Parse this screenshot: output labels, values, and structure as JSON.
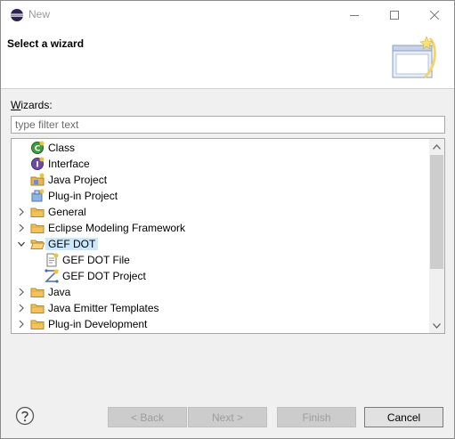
{
  "window": {
    "title": "New",
    "icon": "eclipse-icon"
  },
  "banner": {
    "title": "Select a wizard",
    "art_icon": "new-wizard-banner-icon"
  },
  "wizards": {
    "label_prefix": "W",
    "label_rest": "izards:",
    "filter_placeholder": "type filter text"
  },
  "tree": {
    "items": [
      {
        "label": "Class",
        "icon": "java-class-icon",
        "expandable": false,
        "expanded": false
      },
      {
        "label": "Interface",
        "icon": "java-interface-icon",
        "expandable": false,
        "expanded": false
      },
      {
        "label": "Java Project",
        "icon": "java-project-icon",
        "expandable": false,
        "expanded": false
      },
      {
        "label": "Plug-in Project",
        "icon": "plugin-project-icon",
        "expandable": false,
        "expanded": false
      },
      {
        "label": "General",
        "icon": "folder-icon",
        "expandable": true,
        "expanded": false
      },
      {
        "label": "Eclipse Modeling Framework",
        "icon": "folder-icon",
        "expandable": true,
        "expanded": false
      },
      {
        "label": "GEF DOT",
        "icon": "folder-open-icon",
        "expandable": true,
        "expanded": true,
        "selected": true
      },
      {
        "label": "GEF DOT File",
        "icon": "dot-file-icon",
        "expandable": false,
        "expanded": false,
        "child": true
      },
      {
        "label": "GEF DOT Project",
        "icon": "dot-project-icon",
        "expandable": false,
        "expanded": false,
        "child": true
      },
      {
        "label": "Java",
        "icon": "folder-icon",
        "expandable": true,
        "expanded": false
      },
      {
        "label": "Java Emitter Templates",
        "icon": "folder-icon",
        "expandable": true,
        "expanded": false
      },
      {
        "label": "Plug-in Development",
        "icon": "folder-icon",
        "expandable": true,
        "expanded": false
      }
    ]
  },
  "buttons": {
    "back": "< Back",
    "next": "Next >",
    "finish": "Finish",
    "cancel": "Cancel"
  },
  "colors": {
    "selection": "#cce8ff",
    "folder": "#e8b64c"
  }
}
